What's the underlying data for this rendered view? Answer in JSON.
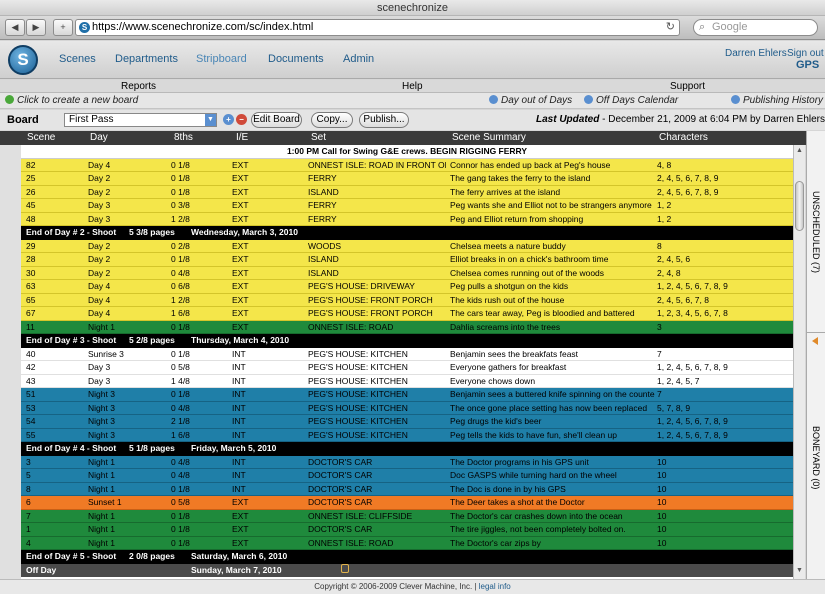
{
  "window": {
    "title": "scenechronize"
  },
  "browser": {
    "url": "https://www.scenechronize.com/sc/index.html",
    "search_placeholder": "Google",
    "back_icon": "back-arrow-icon",
    "forward_icon": "forward-arrow-icon",
    "add_icon": "plus-icon"
  },
  "app": {
    "logo_letter": "S",
    "nav": [
      "Scenes",
      "Departments",
      "Stripboard",
      "Documents",
      "Admin"
    ],
    "active_nav": "Stripboard",
    "user": "Darren Ehlers",
    "signout": "Sign out",
    "project": "GPS"
  },
  "menus": [
    "Reports",
    "Help",
    "Support"
  ],
  "actions": {
    "create": "Click to create a new board",
    "day_out": "Day out of Days",
    "off_days": "Off Days Calendar",
    "history": "Publishing History"
  },
  "board": {
    "label": "Board",
    "selected": "First Pass",
    "edit": "Edit Board",
    "copy": "Copy...",
    "publish": "Publish...",
    "updated_label": "Last Updated",
    "updated_value": " - December 21, 2009 at 6:04 PM by Darren Ehlers"
  },
  "columns": [
    "Scene",
    "Day",
    "8ths",
    "I/E",
    "Set",
    "Scene Summary",
    "Characters"
  ],
  "rows": [
    {
      "kind": "note",
      "text": "1:00 PM Call for Swing G&E crews. BEGIN RIGGING FERRY"
    },
    {
      "kind": "yellow",
      "cells": [
        "82",
        "Day 4",
        "0 1/8",
        "EXT",
        "ONNEST ISLE: ROAD IN FRONT OF HO...",
        "Connor has ended up back at Peg's house",
        "4, 8"
      ]
    },
    {
      "kind": "yellow",
      "cells": [
        "25",
        "Day 2",
        "0 1/8",
        "EXT",
        "FERRY",
        "The gang takes the ferry to the island",
        "2, 4, 5, 6, 7, 8, 9"
      ]
    },
    {
      "kind": "yellow",
      "cells": [
        "26",
        "Day 2",
        "0 1/8",
        "EXT",
        "ISLAND",
        "The ferry arrives at the island",
        "2, 4, 5, 6, 7, 8, 9"
      ]
    },
    {
      "kind": "yellow",
      "cells": [
        "45",
        "Day 3",
        "0 3/8",
        "EXT",
        "FERRY",
        "Peg wants she and Elliot not to be strangers anymore",
        "1, 2"
      ]
    },
    {
      "kind": "yellow",
      "cells": [
        "48",
        "Day 3",
        "1 2/8",
        "EXT",
        "FERRY",
        "Peg and Elliot return from shopping",
        "1, 2"
      ]
    },
    {
      "kind": "black",
      "label": "End of Day # 2 - Shoot",
      "pages": "5 3/8 pages",
      "date": "Wednesday, March 3, 2010"
    },
    {
      "kind": "yellow",
      "cells": [
        "29",
        "Day 2",
        "0 2/8",
        "EXT",
        "WOODS",
        "Chelsea meets a nature buddy",
        "8"
      ]
    },
    {
      "kind": "yellow",
      "cells": [
        "28",
        "Day 2",
        "0 1/8",
        "EXT",
        "ISLAND",
        "Elliot breaks in on a chick's bathroom time",
        "2, 4, 5, 6"
      ]
    },
    {
      "kind": "yellow",
      "cells": [
        "30",
        "Day 2",
        "0 4/8",
        "EXT",
        "ISLAND",
        "Chelsea comes running out of the woods",
        "2, 4, 8"
      ]
    },
    {
      "kind": "yellow",
      "cells": [
        "63",
        "Day 4",
        "0 6/8",
        "EXT",
        "PEG'S HOUSE: DRIVEWAY",
        "Peg pulls a shotgun on the kids",
        "1, 2, 4, 5, 6, 7, 8, 9"
      ]
    },
    {
      "kind": "yellow",
      "cells": [
        "65",
        "Day 4",
        "1 2/8",
        "EXT",
        "PEG'S HOUSE: FRONT PORCH",
        "The kids rush out of the house",
        "2, 4, 5, 6, 7, 8"
      ]
    },
    {
      "kind": "yellow",
      "cells": [
        "67",
        "Day 4",
        "1 6/8",
        "EXT",
        "PEG'S HOUSE: FRONT PORCH",
        "The cars tear away, Peg is bloodied and battered",
        "1, 2, 3, 4, 5, 6, 7, 8"
      ]
    },
    {
      "kind": "green",
      "cells": [
        "11",
        "Night 1",
        "0 1/8",
        "EXT",
        "ONNEST ISLE: ROAD",
        "Dahlia screams into the trees",
        "3"
      ]
    },
    {
      "kind": "black",
      "label": "End of Day # 3 - Shoot",
      "pages": "5 2/8 pages",
      "date": "Thursday, March 4, 2010"
    },
    {
      "kind": "white",
      "cells": [
        "40",
        "Sunrise 3",
        "0 1/8",
        "INT",
        "PEG'S HOUSE: KITCHEN",
        "Benjamin sees the breakfats feast",
        "7"
      ]
    },
    {
      "kind": "white",
      "cells": [
        "42",
        "Day 3",
        "0 5/8",
        "INT",
        "PEG'S HOUSE: KITCHEN",
        "Everyone gathers for breakfast",
        "1, 2, 4, 5, 6, 7, 8, 9"
      ]
    },
    {
      "kind": "white",
      "cells": [
        "43",
        "Day 3",
        "1 4/8",
        "INT",
        "PEG'S HOUSE: KITCHEN",
        "Everyone chows down",
        "1, 2, 4, 5, 7"
      ]
    },
    {
      "kind": "blue",
      "cells": [
        "51",
        "Night 3",
        "0 1/8",
        "INT",
        "PEG'S HOUSE: KITCHEN",
        "Benjamin sees a buttered knife spinning on the counter...",
        "7"
      ]
    },
    {
      "kind": "blue",
      "cells": [
        "53",
        "Night 3",
        "0 4/8",
        "INT",
        "PEG'S HOUSE: KITCHEN",
        "The once gone place setting has now been replaced",
        "5, 7, 8, 9"
      ]
    },
    {
      "kind": "blue",
      "cells": [
        "54",
        "Night 3",
        "2 1/8",
        "INT",
        "PEG'S HOUSE: KITCHEN",
        "Peg drugs the kid's beer",
        "1, 2, 4, 5, 6, 7, 8, 9"
      ]
    },
    {
      "kind": "blue",
      "cells": [
        "55",
        "Night 3",
        "1 6/8",
        "INT",
        "PEG'S HOUSE: KITCHEN",
        "Peg tells the kids to have fun, she'll clean up",
        "1, 2, 4, 5, 6, 7, 8, 9"
      ]
    },
    {
      "kind": "black",
      "label": "End of Day # 4 - Shoot",
      "pages": "5 1/8 pages",
      "date": "Friday, March 5, 2010"
    },
    {
      "kind": "blue",
      "cells": [
        "3",
        "Night 1",
        "0 4/8",
        "INT",
        "DOCTOR'S CAR",
        "The Doctor programs in his GPS unit",
        "10"
      ]
    },
    {
      "kind": "blue",
      "cells": [
        "5",
        "Night 1",
        "0 4/8",
        "INT",
        "DOCTOR'S CAR",
        "Doc GASPS while turning hard on the wheel",
        "10"
      ]
    },
    {
      "kind": "blue",
      "cells": [
        "8",
        "Night 1",
        "0 1/8",
        "INT",
        "DOCTOR'S CAR",
        "The Doc is done in by his GPS",
        "10"
      ]
    },
    {
      "kind": "orange",
      "cells": [
        "6",
        "Sunset 1",
        "0 5/8",
        "EXT",
        "DOCTOR'S CAR",
        "The Deer takes a shot at the Doctor",
        "10"
      ]
    },
    {
      "kind": "green",
      "cells": [
        "7",
        "Night 1",
        "0 1/8",
        "EXT",
        "ONNEST ISLE: CLIFFSIDE",
        "The Doctor's car crashes down into the ocean",
        "10"
      ]
    },
    {
      "kind": "green",
      "cells": [
        "1",
        "Night 1",
        "0 1/8",
        "EXT",
        "DOCTOR'S CAR",
        "The tire jiggles, not been completely bolted on.",
        "10"
      ]
    },
    {
      "kind": "green",
      "cells": [
        "4",
        "Night 1",
        "0 1/8",
        "EXT",
        "ONNEST ISLE: ROAD",
        "The Doctor's car zips by",
        "10"
      ]
    },
    {
      "kind": "black",
      "label": "End of Day # 5 - Shoot",
      "pages": "2 0/8 pages",
      "date": "Saturday, March 6, 2010"
    },
    {
      "kind": "off",
      "label": "Off Day",
      "pages": "",
      "date": "Sunday, March 7, 2010"
    }
  ],
  "side": {
    "unscheduled": "UNSCHEDULED (7)",
    "boneyard": "BONEYARD (0)"
  },
  "footer": {
    "copyright": "Copyright © 2006-2009 Clever Machine, Inc. | ",
    "legal": "legal info"
  },
  "colors": {
    "yellow": "#f4e64a",
    "green": "#1f8a3c",
    "blue": "#1f7fa8",
    "orange": "#f07a25",
    "black": "#000000"
  }
}
